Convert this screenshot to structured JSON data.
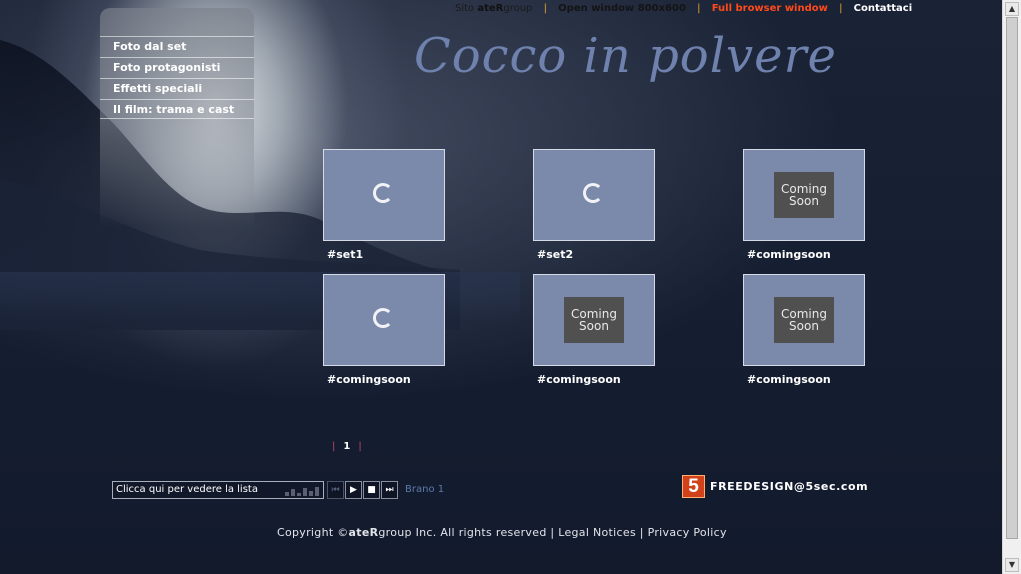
{
  "topnav": {
    "sito_prefix": "Sito ",
    "sito_brand_bold": "ateR",
    "sito_brand_rest": "group",
    "open_window": "Open window 800x600",
    "full_browser": "Full browser window",
    "contact": "Contattaci"
  },
  "menu": {
    "items": [
      {
        "label": "Foto dal set"
      },
      {
        "label": "Foto protagonisti"
      },
      {
        "label": "Effetti speciali"
      },
      {
        "label": "Il film: trama e cast"
      }
    ]
  },
  "title": "Cocco in polvere",
  "gallery": {
    "items": [
      {
        "label": "#set1",
        "state": "loading"
      },
      {
        "label": "#set2",
        "state": "loading"
      },
      {
        "label": "#comingsoon",
        "state": "coming-soon",
        "badge": "Coming\nSoon"
      },
      {
        "label": "#comingsoon",
        "state": "loading"
      },
      {
        "label": "#comingsoon",
        "state": "coming-soon",
        "badge": "Coming\nSoon"
      },
      {
        "label": "#comingsoon",
        "state": "coming-soon",
        "badge": "Coming\nSoon"
      }
    ]
  },
  "pager": {
    "current": "1"
  },
  "player": {
    "playlist_text": "Clicca qui per vedere la lista",
    "track": "Brano 1",
    "icons": {
      "prev": "prev-icon",
      "play": "play-icon",
      "stop": "stop-icon",
      "next": "next-icon"
    }
  },
  "footer": {
    "logo_mark": "5",
    "freedesign": "FREEDESIGN@5sec.com",
    "copyright_prefix": "Copyright ©",
    "copyright_brand_bold": "ateR",
    "copyright_brand_rest": "group Inc. All rights reserved",
    "legal": "Legal Notices",
    "privacy": "Privacy Policy"
  },
  "colors": {
    "background": "#141c30",
    "thumb": "#7b89ab",
    "title": "#6f82ad",
    "accent_red": "#ff4a1a",
    "separator": "#e8a22c"
  }
}
